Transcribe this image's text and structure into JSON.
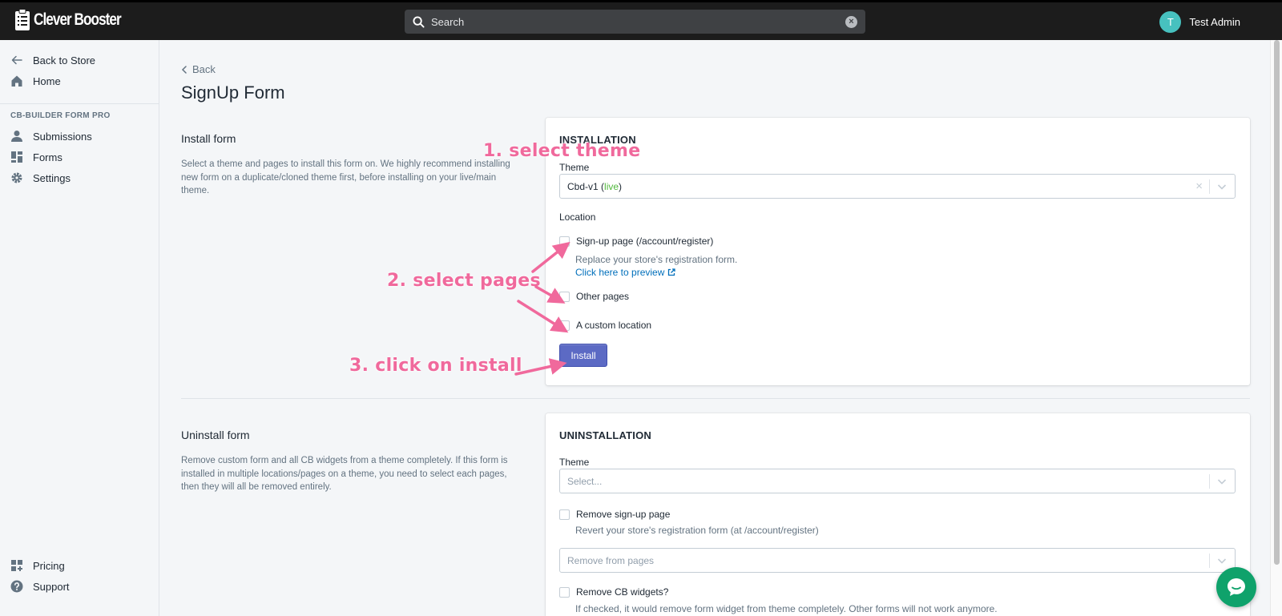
{
  "app": {
    "logo_text": "Clever Booster",
    "search_placeholder": "Search",
    "user_initial": "T",
    "user_name": "Test Admin"
  },
  "sidebar": {
    "back_to_store": "Back to Store",
    "home": "Home",
    "section_title": "CB-BUILDER FORM PRO",
    "items": [
      "Submissions",
      "Forms",
      "Settings"
    ],
    "bottom_items": [
      "Pricing",
      "Support"
    ]
  },
  "page": {
    "back_label": "Back",
    "title": "SignUp Form"
  },
  "install_section": {
    "title": "Install form",
    "description": "Select a theme and pages to install this form on. We highly recommend installing new form on a duplicate/cloned theme first, before installing on your live/main theme.",
    "card_heading": "INSTALLATION",
    "theme_label": "Theme",
    "theme_value": "Cbd-v1",
    "theme_status": "live",
    "location_label": "Location",
    "options": [
      {
        "label": "Sign-up page (/account/register)",
        "help": "Replace your store's registration form.",
        "link": "Click here to preview"
      },
      {
        "label": "Other pages"
      },
      {
        "label": "A custom location"
      }
    ],
    "install_button": "Install"
  },
  "uninstall_section": {
    "title": "Uninstall form",
    "description": "Remove custom form and all CB widgets from a theme completely. If this form is installed in multiple locations/pages on a theme, you need to select each pages, then they will all be removed entirely.",
    "card_heading": "UNINSTALLATION",
    "theme_label": "Theme",
    "theme_placeholder": "Select...",
    "remove_signup_label": "Remove sign-up page",
    "remove_signup_help": "Revert your store's registration form (at /account/register)",
    "remove_pages_placeholder": "Remove from pages",
    "remove_widgets_label": "Remove CB widgets?",
    "remove_widgets_help": "If checked, it would remove form widget from theme completely. Other forms will not work anymore."
  },
  "annotations": {
    "step1": "1. select theme",
    "step2": "2. select pages",
    "step3": "3. click on install"
  },
  "colors": {
    "topbar": "#1c1c1c",
    "primary_button": "#5c6ac4",
    "live_status": "#50b83c",
    "link": "#006fbb",
    "annotation": "#f0699c",
    "chat": "#0fa26b"
  }
}
